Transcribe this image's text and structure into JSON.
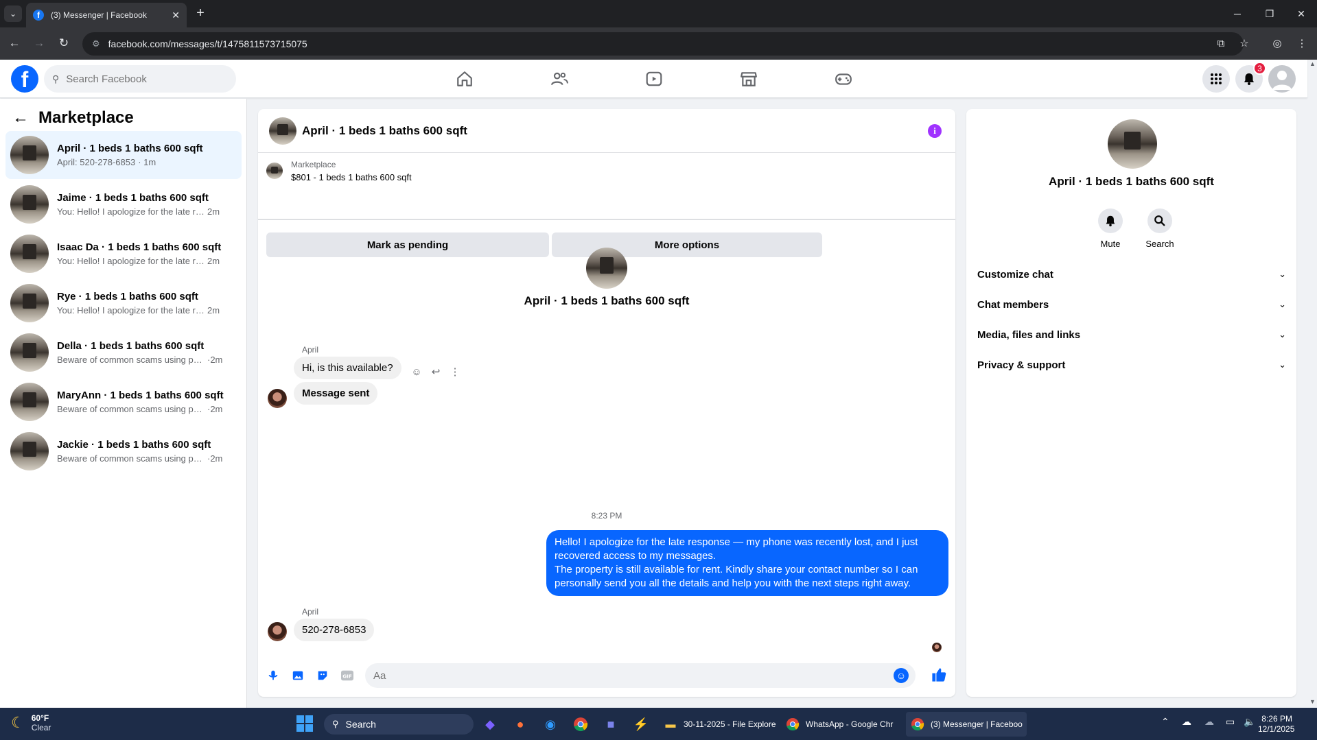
{
  "browser": {
    "tab_title": "(3) Messenger | Facebook",
    "url": "facebook.com/messages/t/1475811573715075"
  },
  "fb": {
    "search_placeholder": "Search Facebook",
    "notification_count": "3",
    "accent": "#0866ff"
  },
  "left": {
    "title": "Marketplace",
    "conversations": [
      {
        "name": "April · 1 beds 1 baths 600 sqft",
        "preview": "April: 520-278-6853",
        "time": "· 1m",
        "active": true
      },
      {
        "name": "Jaime · 1 beds 1 baths 600 sqft",
        "preview": "You: Hello! I apologize for the late re...",
        "time": "2m"
      },
      {
        "name": "Isaac Da · 1 beds 1 baths 600 sqft",
        "preview": "You: Hello! I apologize for the late re...",
        "time": "2m"
      },
      {
        "name": "Rye · 1 beds 1 baths 600 sqft",
        "preview": "You: Hello! I apologize for the late re...",
        "time": "2m"
      },
      {
        "name": "Della · 1 beds 1 baths 600 sqft",
        "preview": "Beware of common scams using pay...",
        "time": "·2m"
      },
      {
        "name": "MaryAnn · 1 beds 1 baths 600 sqft",
        "preview": "Beware of common scams using pay...",
        "time": "·2m"
      },
      {
        "name": "Jackie · 1 beds 1 baths 600 sqft",
        "preview": "Beware of common scams using pay...",
        "time": "·2m"
      }
    ]
  },
  "chat": {
    "title": "April · 1 beds 1 baths 600 sqft",
    "listing_label": "Marketplace",
    "listing_price": "$801 - 1 beds 1 baths 600 sqft",
    "mark_pending": "Mark as pending",
    "more_options": "More options",
    "center_name": "April · 1 beds 1 baths 600 sqft",
    "sender1": "April",
    "msg1": "Hi, is this available?",
    "msg2": "Message sent",
    "timestamp": "8:23 PM",
    "out_msg_line1": "Hello! I apologize for the late response — my phone was recently lost, and I just recovered access to my messages.",
    "out_msg_line2": "The property is still available for rent. Kindly share your contact number so I can personally send you all the details and help you with the next steps right away.",
    "sender2": "April",
    "msg3": "520-278-6853",
    "composer_placeholder": "Aa"
  },
  "right": {
    "name": "April · 1 beds 1 baths 600 sqft",
    "mute": "Mute",
    "search": "Search",
    "sections": [
      "Customize chat",
      "Chat members",
      "Media, files and links",
      "Privacy & support"
    ]
  },
  "taskbar": {
    "temp": "60°F",
    "condition": "Clear",
    "search": "Search",
    "tasks": [
      "30-11-2025 - File Explore",
      "WhatsApp - Google Chr",
      "(3) Messenger | Faceboo"
    ],
    "time": "8:26 PM",
    "date": "12/1/2025"
  }
}
